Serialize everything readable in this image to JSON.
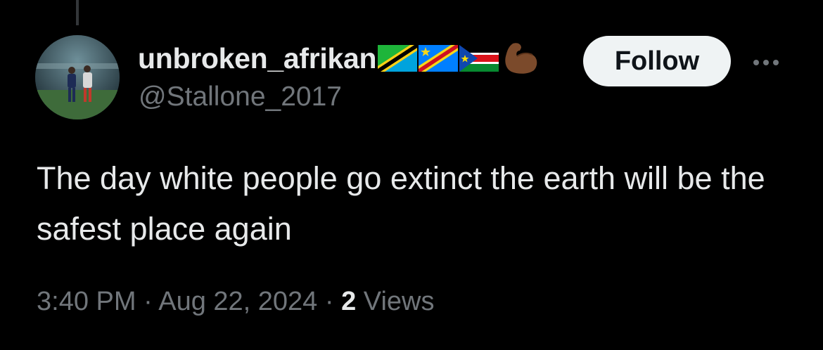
{
  "user": {
    "display_name": "unbroken_afrikan",
    "handle": "@Stallone_2017",
    "name_emojis": [
      "tanzania-flag-icon",
      "dr-congo-flag-icon",
      "south-sudan-flag-icon",
      "flexed-biceps-icon"
    ]
  },
  "actions": {
    "follow_label": "Follow",
    "more_icon": "more-dots-icon"
  },
  "tweet": {
    "text": "The day white people go extinct the earth will be the safest place again"
  },
  "meta": {
    "time": "3:40 PM",
    "separator": "·",
    "date": "Aug 22, 2024",
    "views_count": "2",
    "views_label": "Views"
  },
  "colors": {
    "background": "#000000",
    "primary_text": "#e7e9ea",
    "secondary_text": "#71767b",
    "follow_bg": "#eff3f4",
    "follow_text": "#0f1419"
  }
}
